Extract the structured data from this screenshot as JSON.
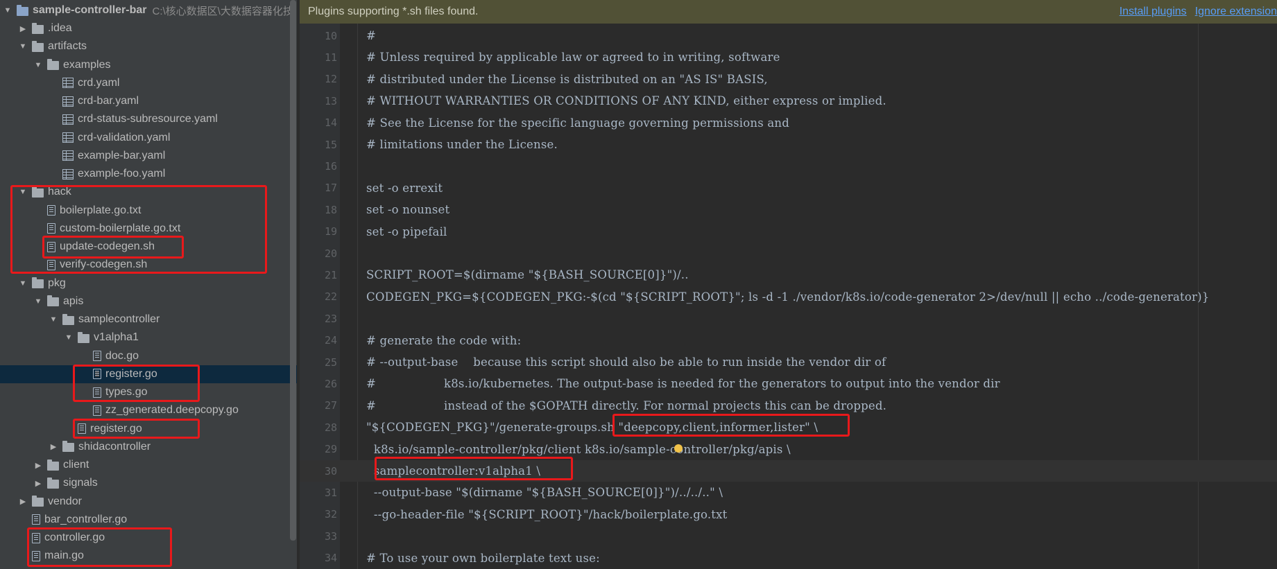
{
  "tree": {
    "root": {
      "name": "sample-controller-bar",
      "path": "C:\\核心数据区\\大数据容器化技"
    },
    "items": [
      {
        "label": ".idea",
        "type": "folder",
        "expanded": false
      },
      {
        "label": "artifacts",
        "type": "folder",
        "expanded": true
      },
      {
        "label": "examples",
        "type": "folder",
        "expanded": true
      },
      {
        "label": "crd.yaml",
        "type": "yaml"
      },
      {
        "label": "crd-bar.yaml",
        "type": "yaml"
      },
      {
        "label": "crd-status-subresource.yaml",
        "type": "yaml"
      },
      {
        "label": "crd-validation.yaml",
        "type": "yaml"
      },
      {
        "label": "example-bar.yaml",
        "type": "yaml"
      },
      {
        "label": "example-foo.yaml",
        "type": "yaml"
      },
      {
        "label": "hack",
        "type": "folder",
        "expanded": true
      },
      {
        "label": "boilerplate.go.txt",
        "type": "file"
      },
      {
        "label": "custom-boilerplate.go.txt",
        "type": "file"
      },
      {
        "label": "update-codegen.sh",
        "type": "file"
      },
      {
        "label": "verify-codegen.sh",
        "type": "file"
      },
      {
        "label": "pkg",
        "type": "folder",
        "expanded": true
      },
      {
        "label": "apis",
        "type": "folder",
        "expanded": true
      },
      {
        "label": "samplecontroller",
        "type": "folder",
        "expanded": true
      },
      {
        "label": "v1alpha1",
        "type": "folder",
        "expanded": true
      },
      {
        "label": "doc.go",
        "type": "file"
      },
      {
        "label": "register.go",
        "type": "file",
        "selected": true
      },
      {
        "label": "types.go",
        "type": "file"
      },
      {
        "label": "zz_generated.deepcopy.go",
        "type": "file"
      },
      {
        "label": "register.go",
        "type": "file"
      },
      {
        "label": "shidacontroller",
        "type": "folder",
        "expanded": false
      },
      {
        "label": "client",
        "type": "folder",
        "expanded": false
      },
      {
        "label": "signals",
        "type": "folder",
        "expanded": false
      },
      {
        "label": "vendor",
        "type": "folder",
        "expanded": false
      },
      {
        "label": "bar_controller.go",
        "type": "file"
      },
      {
        "label": "controller.go",
        "type": "file"
      },
      {
        "label": "main.go",
        "type": "file"
      }
    ]
  },
  "banner": {
    "text": "Plugins supporting *.sh files found.",
    "install_label": "Install plugins",
    "ignore_label": "Ignore extension"
  },
  "editor": {
    "lines": [
      {
        "n": "10",
        "text": "#"
      },
      {
        "n": "11",
        "text": "# Unless required by applicable law or agreed to in writing, software"
      },
      {
        "n": "12",
        "text": "# distributed under the License is distributed on an \"AS IS\" BASIS,"
      },
      {
        "n": "13",
        "text": "# WITHOUT WARRANTIES OR CONDITIONS OF ANY KIND, either express or implied."
      },
      {
        "n": "14",
        "text": "# See the License for the specific language governing permissions and"
      },
      {
        "n": "15",
        "text": "# limitations under the License."
      },
      {
        "n": "16",
        "text": ""
      },
      {
        "n": "17",
        "text": "set -o errexit"
      },
      {
        "n": "18",
        "text": "set -o nounset"
      },
      {
        "n": "19",
        "text": "set -o pipefail"
      },
      {
        "n": "20",
        "text": ""
      },
      {
        "n": "21",
        "text": "SCRIPT_ROOT=$(dirname \"${BASH_SOURCE[0]}\")/.."
      },
      {
        "n": "22",
        "text": "CODEGEN_PKG=${CODEGEN_PKG:-$(cd \"${SCRIPT_ROOT}\"; ls -d -1 ./vendor/k8s.io/code-generator 2>/dev/null || echo ../code-generator)}"
      },
      {
        "n": "23",
        "text": ""
      },
      {
        "n": "24",
        "text": "# generate the code with:"
      },
      {
        "n": "25",
        "text": "# --output-base    because this script should also be able to run inside the vendor dir of"
      },
      {
        "n": "26",
        "text": "#                  k8s.io/kubernetes. The output-base is needed for the generators to output into the vendor dir"
      },
      {
        "n": "27",
        "text": "#                  instead of the $GOPATH directly. For normal projects this can be dropped."
      },
      {
        "n": "28",
        "text": "\"${CODEGEN_PKG}\"/generate-groups.sh \"deepcopy,client,informer,lister\" \\"
      },
      {
        "n": "29",
        "text": "  k8s.io/sample-controller/pkg/client k8s.io/sample-controller/pkg/apis \\"
      },
      {
        "n": "30",
        "text": "  samplecontroller:v1alpha1 \\"
      },
      {
        "n": "31",
        "text": "  --output-base \"$(dirname \"${BASH_SOURCE[0]}\")/../../..\" \\"
      },
      {
        "n": "32",
        "text": "  --go-header-file \"${SCRIPT_ROOT}\"/hack/boilerplate.go.txt"
      },
      {
        "n": "33",
        "text": ""
      },
      {
        "n": "34",
        "text": "# To use your own boilerplate text use:"
      }
    ]
  }
}
